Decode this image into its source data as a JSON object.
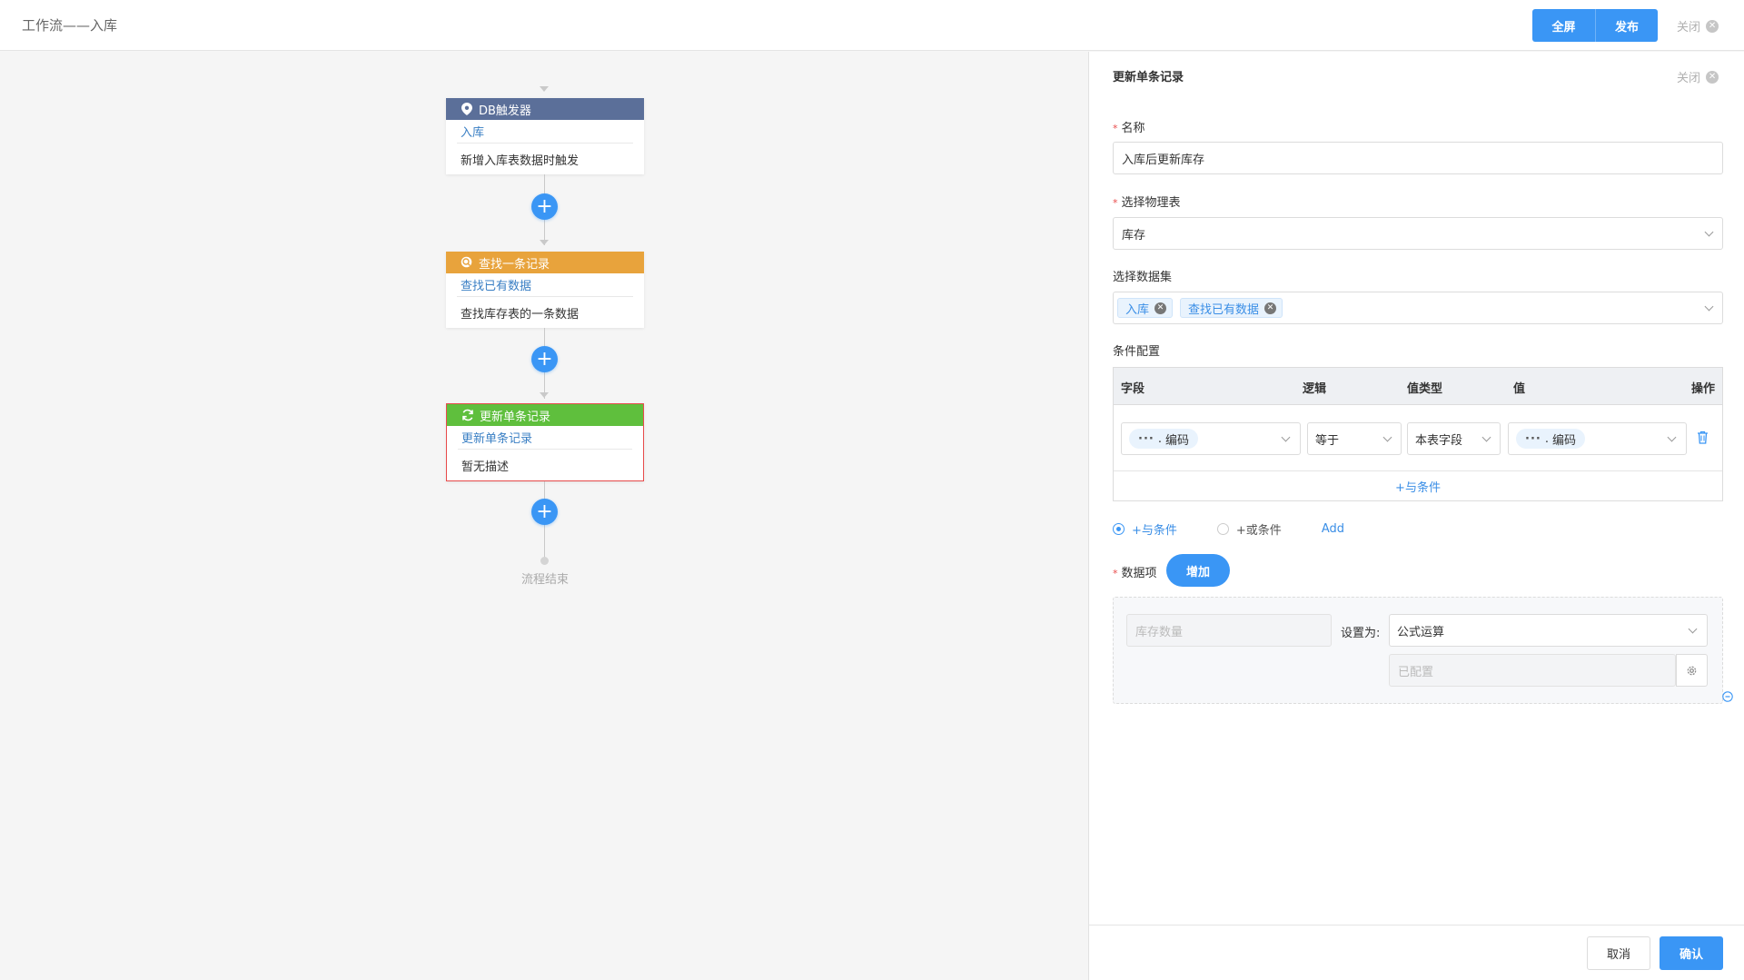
{
  "header": {
    "title": "工作流——入库",
    "fullscreen_label": "全屏",
    "publish_label": "发布",
    "close_label": "关闭"
  },
  "flow": {
    "nodes": [
      {
        "type": "DB触发器",
        "name": "入库",
        "description": "新增入库表数据时触发",
        "color": "#5b6f99",
        "icon": "map-pin-icon"
      },
      {
        "type": "查找一条记录",
        "name": "查找已有数据",
        "description": "查找库存表的一条数据",
        "color": "#e8a33c",
        "icon": "search-icon"
      },
      {
        "type": "更新单条记录",
        "name": "更新单条记录",
        "description": "暂无描述",
        "color": "#5fbf3d",
        "icon": "refresh-icon"
      }
    ],
    "end_label": "流程结束"
  },
  "panel": {
    "title": "更新单条记录",
    "close_label": "关闭",
    "name_label": "名称",
    "name_value": "入库后更新库存",
    "table_label": "选择物理表",
    "table_value": "库存",
    "dataset_label": "选择数据集",
    "dataset_tags": [
      "入库",
      "查找已有数据"
    ],
    "condition_label": "条件配置",
    "condition_columns": [
      "字段",
      "逻辑",
      "值类型",
      "值",
      "操作"
    ],
    "condition_row": {
      "field_dots": "···",
      "field_sep": ".",
      "field": "编码",
      "logic": "等于",
      "value_type": "本表字段",
      "value_dots": "···",
      "value_sep": ".",
      "value": "编码"
    },
    "add_and_condition": "+与条件",
    "radio_and": "+与条件",
    "radio_or": "+或条件",
    "add_link": "Add",
    "data_items_label": "数据项",
    "add_button": "增加",
    "data_item": {
      "field_placeholder": "库存数量",
      "set_as_label": "设置为:",
      "set_as_value": "公式运算",
      "configured_placeholder": "已配置"
    },
    "cancel_label": "取消",
    "confirm_label": "确认"
  },
  "colors": {
    "primary": "#3a96f5",
    "danger": "#e84b4b"
  }
}
